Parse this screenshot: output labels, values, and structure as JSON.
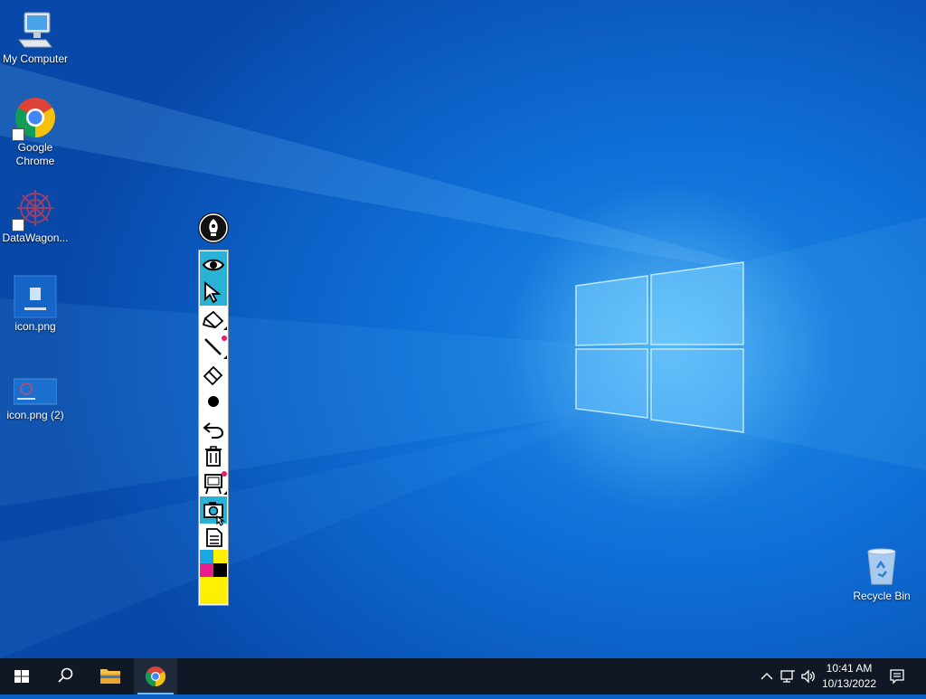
{
  "desktop": {
    "icons": [
      {
        "label": "My Computer"
      },
      {
        "label": "Google Chrome"
      },
      {
        "label": "DataWagon..."
      },
      {
        "label": "icon.png"
      },
      {
        "label": "icon.png (2)"
      },
      {
        "label": "Recycle Bin"
      }
    ]
  },
  "ink_toolbar": {
    "tools": [
      {
        "icon": "eye-icon",
        "active": true
      },
      {
        "icon": "cursor-arrow-icon",
        "active": true
      },
      {
        "icon": "highlighter-icon"
      },
      {
        "icon": "pen-line-icon"
      },
      {
        "icon": "eraser-icon"
      },
      {
        "icon": "brush-dot-icon"
      },
      {
        "icon": "undo-icon"
      },
      {
        "icon": "trash-icon"
      },
      {
        "icon": "whiteboard-icon"
      },
      {
        "icon": "camera-icon"
      },
      {
        "icon": "notes-icon"
      }
    ],
    "palette": [
      "#1aa7e6",
      "#ffef00",
      "#e81e8c",
      "#000000",
      "#ffef00"
    ]
  },
  "taskbar": {
    "clock_time": "10:41 AM",
    "clock_date": "10/13/2022",
    "accent": "#76b9ed"
  }
}
